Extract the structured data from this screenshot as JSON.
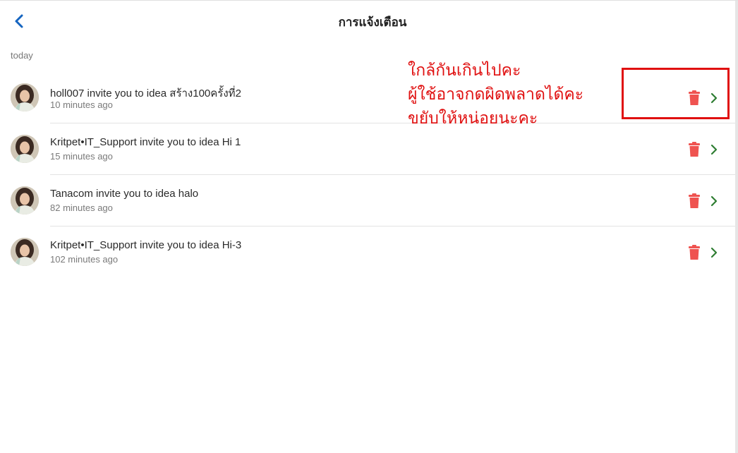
{
  "header": {
    "title": "การแจ้งเตือน",
    "back_icon": "chevron-left-icon"
  },
  "section": {
    "label": "today"
  },
  "notifications": [
    {
      "text": "holl007 invite you to idea สร้าง100ครั้งที่2",
      "time": "10 minutes ago"
    },
    {
      "text": "Kritpet•IT_Support invite you to idea Hi 1",
      "time": "15 minutes ago"
    },
    {
      "text": "Tanacom invite you to idea halo",
      "time": "82 minutes ago"
    },
    {
      "text": "Kritpet•IT_Support invite you to idea Hi-3",
      "time": "102 minutes ago"
    }
  ],
  "annotation": {
    "lines": [
      "ใกล้กันเกินไปคะ",
      "ผู้ใช้อาจกดผิดพลาดได้คะ",
      "ขยับให้หน่อยนะคะ"
    ]
  },
  "colors": {
    "accent_blue": "#1565c0",
    "delete_red": "#ef5350",
    "chevron_green": "#2e7d32",
    "annotation_red": "#e01010"
  }
}
